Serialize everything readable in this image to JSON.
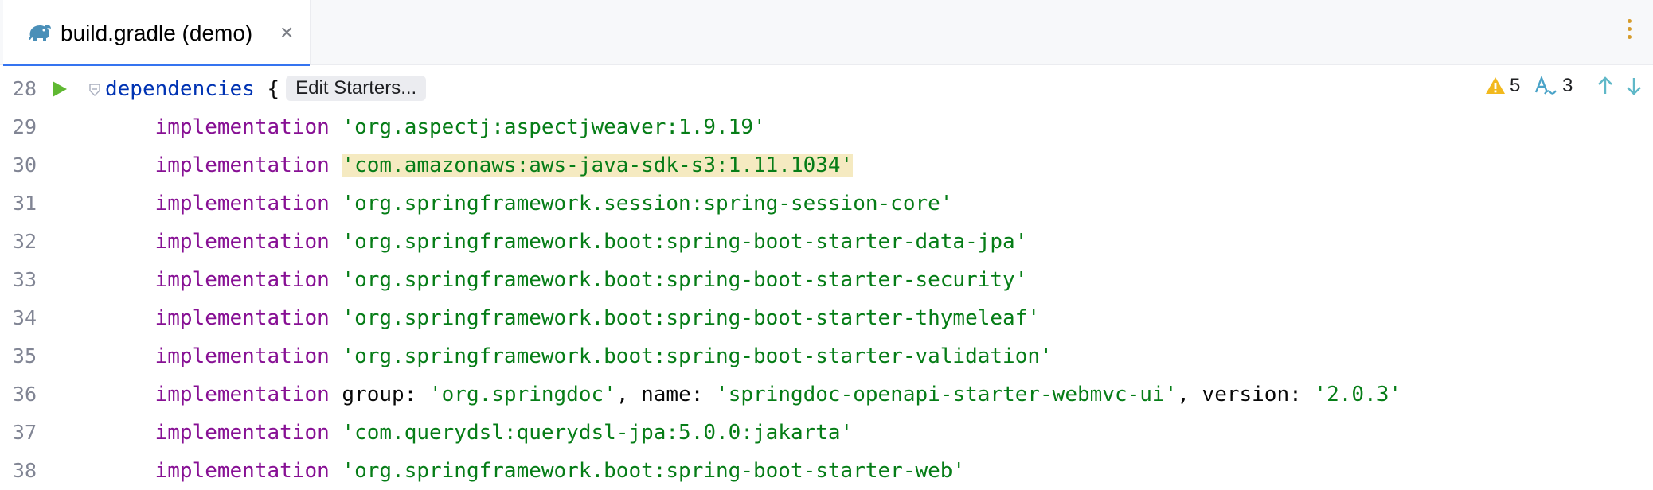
{
  "tab": {
    "title": "build.gradle (demo)",
    "close": "×",
    "icon": "gradle-elephant-icon"
  },
  "colors": {
    "keyword": "#871094",
    "method": "#0033b3",
    "string": "#067d17",
    "highlight": "#f5eac1",
    "run": "#5fb832",
    "warning": "#f2b91d",
    "typo": "#4aa3c8",
    "accent": "#3574f0"
  },
  "inspections": {
    "warnings": "5",
    "typos": "3"
  },
  "editor": {
    "hint": "Edit Starters...",
    "lines": [
      {
        "num": "28",
        "parts": [
          {
            "t": "dependencies",
            "c": "meth"
          },
          {
            "t": " {",
            "c": ""
          }
        ]
      },
      {
        "num": "29",
        "parts": [
          {
            "t": "    implementation",
            "c": "kw"
          },
          {
            "t": " ",
            "c": ""
          },
          {
            "t": "'org.aspectj:aspectjweaver:1.9.19'",
            "c": "str"
          }
        ]
      },
      {
        "num": "30",
        "parts": [
          {
            "t": "    implementation",
            "c": "kw"
          },
          {
            "t": " ",
            "c": ""
          },
          {
            "t": "'com.amazonaws:aws-java-sdk-s3:1.11.1034'",
            "c": "str hl"
          }
        ]
      },
      {
        "num": "31",
        "parts": [
          {
            "t": "    implementation",
            "c": "kw"
          },
          {
            "t": " ",
            "c": ""
          },
          {
            "t": "'org.springframework.session:spring-session-core'",
            "c": "str"
          }
        ]
      },
      {
        "num": "32",
        "parts": [
          {
            "t": "    implementation",
            "c": "kw"
          },
          {
            "t": " ",
            "c": ""
          },
          {
            "t": "'org.springframework.boot:spring-boot-starter-data-jpa'",
            "c": "str"
          }
        ]
      },
      {
        "num": "33",
        "parts": [
          {
            "t": "    implementation",
            "c": "kw"
          },
          {
            "t": " ",
            "c": ""
          },
          {
            "t": "'org.springframework.boot:spring-boot-starter-security'",
            "c": "str"
          }
        ]
      },
      {
        "num": "34",
        "parts": [
          {
            "t": "    implementation",
            "c": "kw"
          },
          {
            "t": " ",
            "c": ""
          },
          {
            "t": "'org.springframework.boot:spring-boot-starter-thymeleaf'",
            "c": "str"
          }
        ]
      },
      {
        "num": "35",
        "parts": [
          {
            "t": "    implementation",
            "c": "kw"
          },
          {
            "t": " ",
            "c": ""
          },
          {
            "t": "'org.springframework.boot:spring-boot-starter-validation'",
            "c": "str"
          }
        ]
      },
      {
        "num": "36",
        "parts": [
          {
            "t": "    implementation",
            "c": "kw"
          },
          {
            "t": " group: ",
            "c": ""
          },
          {
            "t": "'org.springdoc'",
            "c": "str"
          },
          {
            "t": ", name: ",
            "c": ""
          },
          {
            "t": "'springdoc-openapi-starter-webmvc-ui'",
            "c": "str"
          },
          {
            "t": ", version: ",
            "c": ""
          },
          {
            "t": "'2.0.3'",
            "c": "str"
          }
        ]
      },
      {
        "num": "37",
        "parts": [
          {
            "t": "    implementation",
            "c": "kw"
          },
          {
            "t": " ",
            "c": ""
          },
          {
            "t": "'com.querydsl:querydsl-jpa:5.0.0:jakarta'",
            "c": "str"
          }
        ]
      },
      {
        "num": "38",
        "parts": [
          {
            "t": "    implementation",
            "c": "kw"
          },
          {
            "t": " ",
            "c": ""
          },
          {
            "t": "'org.springframework.boot:spring-boot-starter-web'",
            "c": "str"
          }
        ]
      }
    ]
  }
}
